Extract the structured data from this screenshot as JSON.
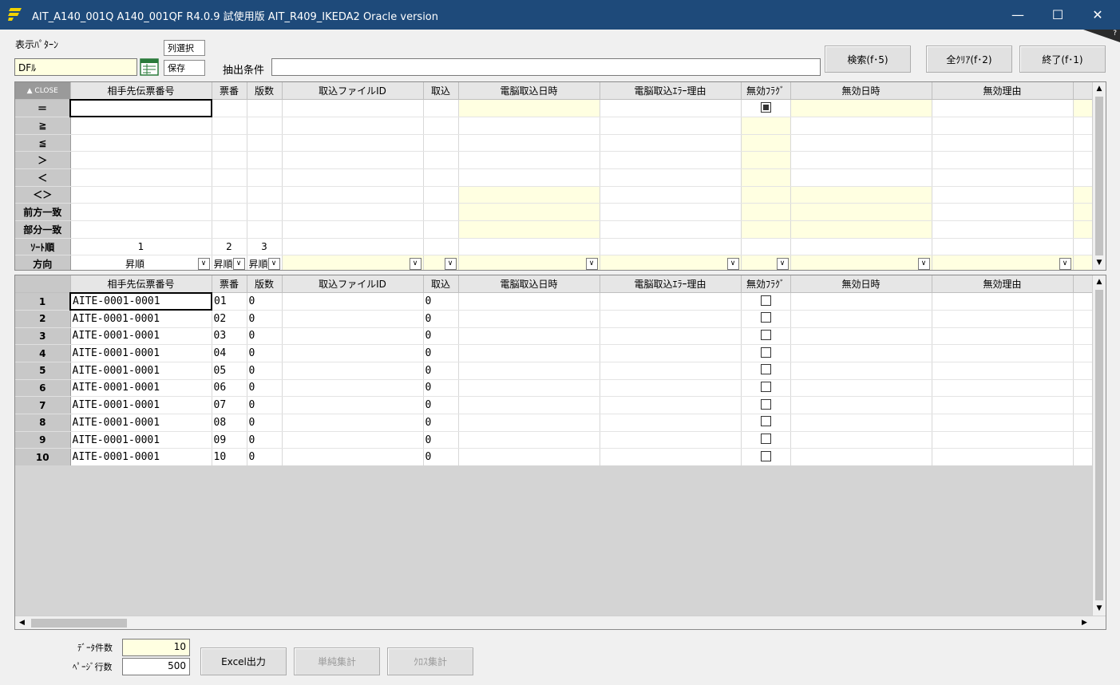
{
  "window": {
    "title": "AIT_A140_001Q  A140_001QF  R4.0.9  試使用版  AIT_R409_IKEDA2  Oracle version",
    "minimize": "—",
    "maximize": "☐",
    "close": "✕",
    "help": "?"
  },
  "toolbar": {
    "pattern_label": "表示ﾊﾟﾀｰﾝ",
    "pattern_value": "DFﾙ",
    "column_select": "列選択",
    "save": "保存",
    "filter_label": "抽出条件",
    "filter_value": "",
    "search": "検索(f･5)",
    "clear_all": "全ｸﾘｱ(f･2)",
    "exit": "終了(f･1)"
  },
  "columns": [
    "相手先伝票番号",
    "票番",
    "版数",
    "取込ファイルID",
    "取込",
    "電脳取込日時",
    "電脳取込ｴﾗｰ理由",
    "無効ﾌﾗｸﾞ",
    "無効日時",
    "無効理由"
  ],
  "condition_grid": {
    "close_label": "CLOSE",
    "row_labels": [
      "＝",
      "≧",
      "≦",
      "＞",
      "＜",
      "＜＞",
      "前方一致",
      "部分一致",
      "ｿｰﾄ順",
      "方向"
    ],
    "sort_order": [
      "1",
      "2",
      "3"
    ],
    "direction": [
      "昇順",
      "昇順",
      "昇順"
    ]
  },
  "result_grid": {
    "rows": [
      {
        "no": "1",
        "slip": "AITE-0001-0001",
        "ticket": "01",
        "version": "0",
        "import": "0"
      },
      {
        "no": "2",
        "slip": "AITE-0001-0001",
        "ticket": "02",
        "version": "0",
        "import": "0"
      },
      {
        "no": "3",
        "slip": "AITE-0001-0001",
        "ticket": "03",
        "version": "0",
        "import": "0"
      },
      {
        "no": "4",
        "slip": "AITE-0001-0001",
        "ticket": "04",
        "version": "0",
        "import": "0"
      },
      {
        "no": "5",
        "slip": "AITE-0001-0001",
        "ticket": "05",
        "version": "0",
        "import": "0"
      },
      {
        "no": "6",
        "slip": "AITE-0001-0001",
        "ticket": "06",
        "version": "0",
        "import": "0"
      },
      {
        "no": "7",
        "slip": "AITE-0001-0001",
        "ticket": "07",
        "version": "0",
        "import": "0"
      },
      {
        "no": "8",
        "slip": "AITE-0001-0001",
        "ticket": "08",
        "version": "0",
        "import": "0"
      },
      {
        "no": "9",
        "slip": "AITE-0001-0001",
        "ticket": "09",
        "version": "0",
        "import": "0"
      },
      {
        "no": "10",
        "slip": "AITE-0001-0001",
        "ticket": "10",
        "version": "0",
        "import": "0"
      }
    ]
  },
  "footer": {
    "data_count_label": "ﾃﾞｰﾀ件数",
    "data_count": "10",
    "page_rows_label": "ﾍﾟｰｼﾞ行数",
    "page_rows": "500",
    "excel": "Excel出力",
    "simple_sum": "単純集計",
    "cross_sum": "ｸﾛｽ集計"
  },
  "colors": {
    "titlebar": "#1e4a7a",
    "yellow_cell": "#ffffe1",
    "row_header": "#c8c8c8"
  }
}
